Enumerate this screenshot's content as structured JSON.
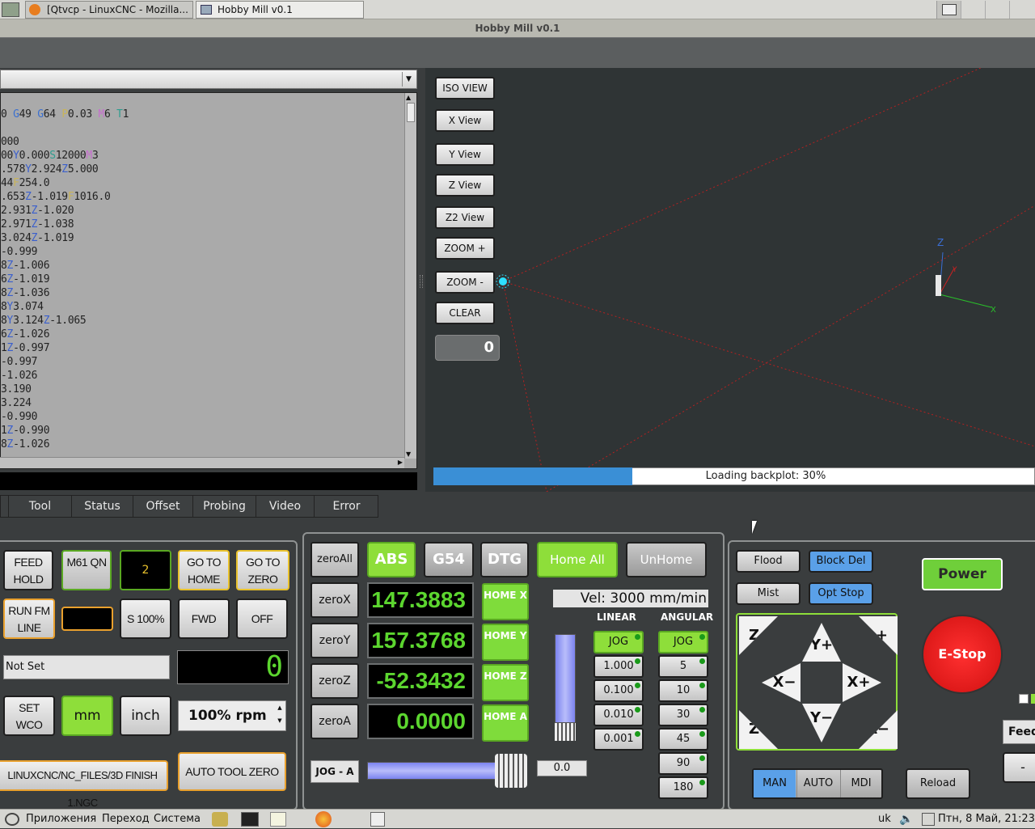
{
  "taskbar_top": {
    "tasks": [
      {
        "label": "[Qtvcp - LinuxCNC - Mozilla..."
      },
      {
        "label": "Hobby Mill v0.1"
      }
    ]
  },
  "window": {
    "title": "Hobby Mill v0.1"
  },
  "gcode": {
    "lines": [
      "0 G49 G64 P0.03 M6 T1",
      "",
      "000",
      "00Y0.000S12000M3",
      ".578Y2.924Z5.000",
      "44F254.0",
      ".653Z-1.019F1016.0",
      "2.931Z-1.020",
      "2.971Z-1.038",
      "3.024Z-1.019",
      "-0.999",
      "8Z-1.006",
      "6Z-1.019",
      "8Z-1.036",
      "8Y3.074",
      "8Y3.124Z-1.065",
      "6Z-1.026",
      "1Z-0.997",
      "-0.997",
      "-1.026",
      "3.190",
      "3.224",
      "-0.990",
      "1Z-0.990",
      "8Z-1.026"
    ]
  },
  "view_buttons": [
    "ISO VIEW",
    "X View",
    "Y View",
    "Z View",
    "Z2 View",
    "ZOOM +",
    "ZOOM -",
    "CLEAR"
  ],
  "view_counter": "0",
  "axis_labels": {
    "z": "Z",
    "y": "Y",
    "x": "X"
  },
  "progress": {
    "text": "Loading backplot: 30%",
    "fraction": 0.3
  },
  "tabs": [
    "Tool",
    "Status",
    "Offset",
    "Probing",
    "Video",
    "Error"
  ],
  "left_controls": {
    "feed_hold": "FEED HOLD",
    "m61_qn": "M61 QN",
    "tool_number": "2",
    "go_to_home": "GO TO HOME",
    "go_to_zero": "GO TO ZERO",
    "run_fm_line": "RUN FM LINE",
    "line_value": "",
    "s100": "S 100%",
    "fwd": "FWD",
    "off": "OFF",
    "not_set": "Not Set",
    "spindle_display": "0",
    "set_wco": "SET WCO",
    "mm": "mm",
    "inch": "inch",
    "rpm": "100% rpm",
    "file_path": "LINUXCNC/NC_FILES/3D FINISH 1.NGC",
    "auto_tool_zero": "AUTO TOOL ZERO"
  },
  "dro": {
    "zero_all": "zeroAll",
    "abs": "ABS",
    "g54": "G54",
    "dtg": "DTG",
    "home_all": "Home All",
    "unhome": "UnHome",
    "velocity": "Vel: 3000 mm/min",
    "axes": [
      {
        "zero": "zeroX",
        "value": "147.3883",
        "home": "HOME X"
      },
      {
        "zero": "zeroY",
        "value": "157.3768",
        "home": "HOME Y"
      },
      {
        "zero": "zeroZ",
        "value": "-52.3432",
        "home": "HOME Z"
      },
      {
        "zero": "zeroA",
        "value": "0.0000",
        "home": "HOME A"
      }
    ],
    "linear_label": "LINEAR",
    "angular_label": "ANGULAR",
    "linear_increments": [
      "JOG",
      "1.000",
      "0.100",
      "0.010",
      "0.001"
    ],
    "angular_increments": [
      "JOG",
      "5",
      "10",
      "30",
      "45",
      "90",
      "180"
    ],
    "jog_axis": "JOG - A",
    "jog_value": "0.0"
  },
  "machine": {
    "flood": "Flood",
    "block_del": "Block Del",
    "mist": "Mist",
    "opt_stop": "Opt Stop",
    "power": "Power",
    "estop": "E-Stop",
    "jog": {
      "z_plus": "Z+",
      "y_plus": "Y+",
      "a_plus": "A+",
      "x_minus": "X−",
      "x_plus": "X+",
      "z_minus": "Z−",
      "y_minus": "Y−",
      "a_minus": "A−"
    },
    "modes": [
      "MAN",
      "AUTO",
      "MDI"
    ],
    "reload": "Reload",
    "feed_partial": "Feed",
    "minus_partial": "-"
  },
  "system_taskbar": {
    "apps": "Приложения",
    "goto": "Переход",
    "system": "Система",
    "layout": "uk",
    "datetime": "Птн, 8 Май, 21:23"
  },
  "colors": {
    "accent_green": "#8ede3a",
    "dro_green": "#5cd62f",
    "progress_blue": "#3a8fd6",
    "estop_red": "#e01818"
  }
}
